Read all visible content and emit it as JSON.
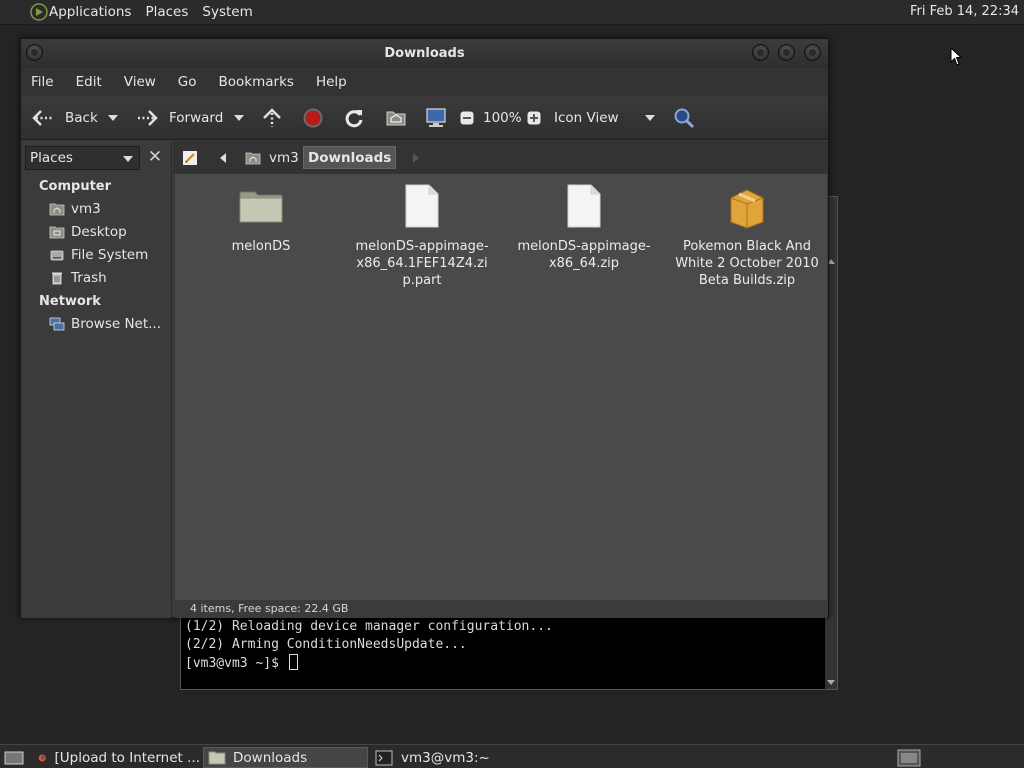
{
  "top_panel": {
    "applications": "Applications",
    "places": "Places",
    "system": "System",
    "clock": "Fri Feb 14, 22:34"
  },
  "window": {
    "title": "Downloads",
    "menu": [
      "File",
      "Edit",
      "View",
      "Go",
      "Bookmarks",
      "Help"
    ],
    "toolbar": {
      "back": "Back",
      "forward": "Forward",
      "zoom": "100%",
      "view_mode": "Icon View"
    },
    "sidebar": {
      "selector": "Places",
      "computer_heading": "Computer",
      "computer_items": [
        "vm3",
        "Desktop",
        "File System",
        "Trash"
      ],
      "network_heading": "Network",
      "network_items": [
        "Browse Net..."
      ]
    },
    "pathbar": {
      "home": "vm3",
      "current": "Downloads"
    },
    "files": [
      {
        "name": "melonDS",
        "type": "folder"
      },
      {
        "name": "melonDS-appimage-x86_64.1FEF14Z4.zip.part",
        "type": "file"
      },
      {
        "name": "melonDS-appimage-x86_64.zip",
        "type": "file"
      },
      {
        "name": "Pokemon Black And White 2 October 2010 Beta Builds.zip",
        "type": "archive"
      }
    ],
    "status": "4 items, Free space: 22.4 GB"
  },
  "terminal": {
    "lines": [
      "(1/2) Reloading device manager configuration...",
      "(2/2) Arming ConditionNeedsUpdate..."
    ],
    "prompt": "[vm3@vm3 ~]$ "
  },
  "taskbar": {
    "tasks": [
      "[Upload to Internet ...",
      "Downloads",
      "vm3@vm3:~"
    ]
  },
  "colors": {
    "panel": "#2b2b2b",
    "window_bg": "#3b3b3b",
    "content_bg": "#4a4a4a",
    "terminal_bg": "#000000"
  }
}
